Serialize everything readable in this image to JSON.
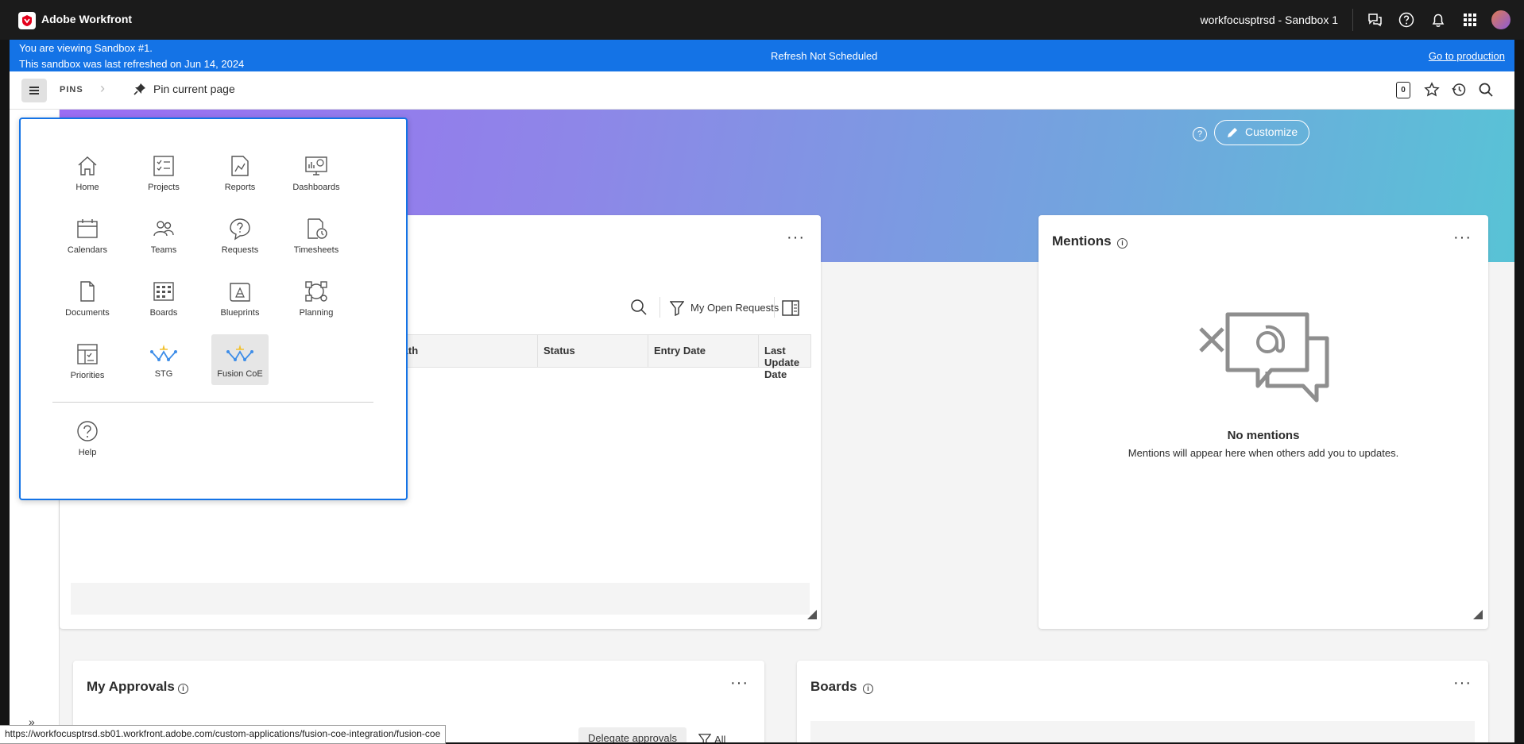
{
  "topbar": {
    "app_name": "Adobe Workfront",
    "tenant": "workfocusptrsd - Sandbox 1",
    "icons": [
      "feedback-icon",
      "help-icon",
      "bell-icon",
      "apps-grid-icon",
      "avatar"
    ]
  },
  "sandbox_banner": {
    "line1": "You are viewing Sandbox #1.",
    "line2": "This sandbox was last refreshed on Jun 14, 2024",
    "status": "Refresh Not Scheduled",
    "go_to_production": "Go to production"
  },
  "pins_bar": {
    "label": "PINS",
    "pin_current": "Pin current page",
    "counter": "0"
  },
  "hero": {
    "customize": "Customize"
  },
  "requests_card": {
    "filter_label": "My Open Requests",
    "columns": [
      "Path",
      "Status",
      "Entry Date",
      "Last Update Date"
    ]
  },
  "mentions_card": {
    "title": "Mentions",
    "empty_title": "No mentions",
    "empty_text": "Mentions will appear here when others add you to updates."
  },
  "approvals_card": {
    "title": "My Approvals",
    "delegate": "Delegate approvals",
    "filter": "All"
  },
  "boards_card": {
    "title": "Boards"
  },
  "main_menu": {
    "items": [
      {
        "label": "Home",
        "icon": "home-icon"
      },
      {
        "label": "Projects",
        "icon": "projects-icon"
      },
      {
        "label": "Reports",
        "icon": "reports-icon"
      },
      {
        "label": "Dashboards",
        "icon": "dashboards-icon"
      },
      {
        "label": "Calendars",
        "icon": "calendar-icon"
      },
      {
        "label": "Teams",
        "icon": "teams-icon"
      },
      {
        "label": "Requests",
        "icon": "requests-icon"
      },
      {
        "label": "Timesheets",
        "icon": "timesheets-icon"
      },
      {
        "label": "Documents",
        "icon": "document-icon"
      },
      {
        "label": "Boards",
        "icon": "boards-icon"
      },
      {
        "label": "Blueprints",
        "icon": "blueprints-icon"
      },
      {
        "label": "Planning",
        "icon": "planning-icon"
      },
      {
        "label": "Priorities",
        "icon": "priorities-icon"
      },
      {
        "label": "STG",
        "icon": "custom-app-icon"
      },
      {
        "label": "Fusion CoE",
        "icon": "custom-app-icon"
      }
    ],
    "selected": "Fusion CoE",
    "help": "Help"
  },
  "status_url": "https://workfocusptrsd.sb01.workfront.adobe.com/custom-applications/fusion-coe-integration/fusion-coe",
  "colors": {
    "sandbox_banner": "#1473e6",
    "menu_border": "#1473e6",
    "topbar": "#1b1b1b"
  }
}
